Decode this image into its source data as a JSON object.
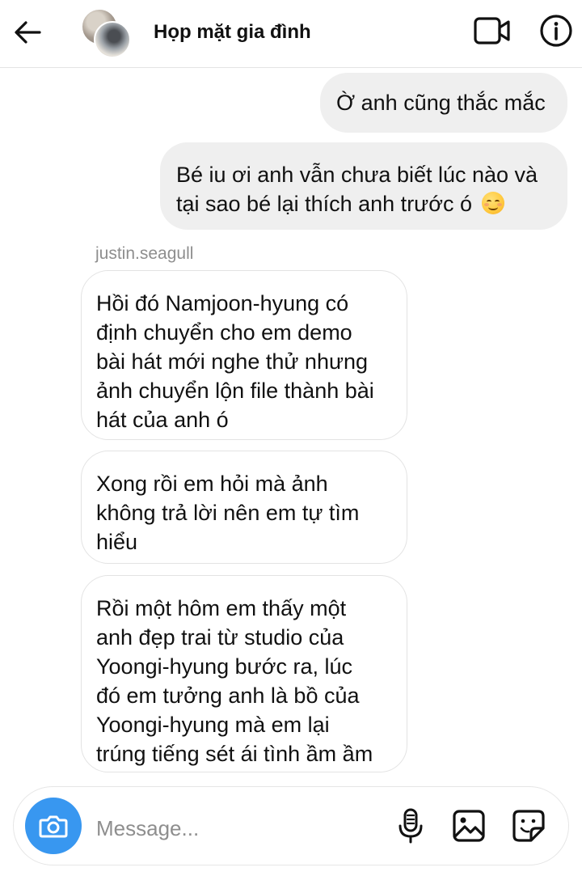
{
  "header": {
    "title": "Họp mặt gia đình",
    "back_icon": "arrow-left-icon",
    "video_icon": "video-camera-icon",
    "info_icon": "info-icon"
  },
  "messages": [
    {
      "direction": "outgoing",
      "text": "Ờ anh cũng thắc mắc"
    },
    {
      "direction": "outgoing",
      "lines": [
        "Bé iu ơi anh vẫn chưa biết lúc nào và",
        "tại sao bé lại thích anh trước ó"
      ],
      "emoji": "smiling-face-emoji"
    },
    {
      "direction": "incoming",
      "sender": "justin.seagull",
      "lines": [
        "Hồi đó Namjoon-hyung có",
        "định chuyển cho em demo",
        "bài hát mới nghe thử nhưng",
        "ảnh chuyển lộn file thành bài",
        "hát của anh ó"
      ]
    },
    {
      "direction": "incoming",
      "lines": [
        "Xong rồi em hỏi mà ảnh",
        "không trả lời nên em tự tìm",
        "hiểu"
      ]
    },
    {
      "direction": "incoming",
      "lines": [
        "Rồi một hôm em thấy một",
        "anh đẹp trai từ studio của",
        "Yoongi-hyung bước ra, lúc",
        "đó em tưởng anh là bồ của",
        "Yoongi-hyung mà em lại",
        "trúng tiếng sét ái tình ầm ầm"
      ]
    }
  ],
  "composer": {
    "placeholder": "Message...",
    "value": "",
    "icons": [
      "camera-icon",
      "microphone-icon",
      "image-icon",
      "sticker-icon"
    ],
    "accent_color": "#3897f0"
  }
}
